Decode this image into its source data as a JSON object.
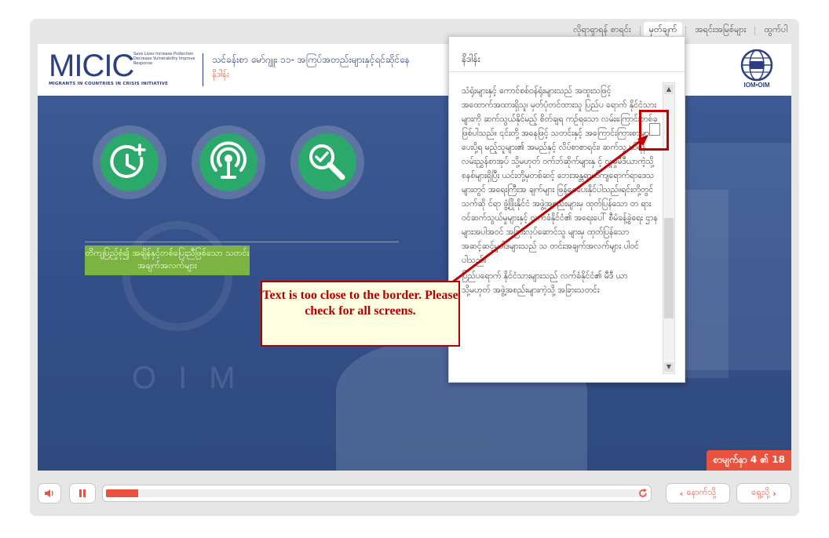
{
  "top_nav": {
    "tabs": [
      {
        "label": "လိုရာရှာရန် စာရင်း",
        "active": false
      },
      {
        "label": "မှတ်ချက်",
        "active": true
      },
      {
        "label": "အရင်းအမြစ်များ",
        "active": false
      },
      {
        "label": "ထွက်ပါ",
        "active": false
      }
    ]
  },
  "header": {
    "logo_word": "MICIC",
    "logo_tagline": "Save Lives Increase Protection Decrease Vulnerability Improve Response",
    "logo_subtitle": "MIGRANTS IN COUNTRIES IN CRISIS INITIATIVE",
    "course_title": "သင်ခန်းစာ မော်ဂျူး ၁၁- အကြပ်အတည်းများနှင့်ရင်ဆိုင်နေ",
    "course_subtitle": "နိဒါန်း",
    "partner_logo_text": "IOM•OIM"
  },
  "stage": {
    "icon_buttons": [
      {
        "icon": "clock-add-icon"
      },
      {
        "icon": "broadcast-icon"
      },
      {
        "icon": "search-check-icon"
      }
    ],
    "green_label": "တိကျပြည့်စုံ၍ အချိန်နှင့်တစ်ပြေးညီဖြစ်သော သတင်းအချက်အလက်များ",
    "background_text": "OIM",
    "counter": "စာမျက်နှာ 4 ၏ 18"
  },
  "popup": {
    "title": "နိဒါန်း",
    "paragraphs": [
      "သံရုံးများနှင့် ကောင်စစ်ဝန်ရုံးများသည် အထူးသဖြင့် အထောက်အထားရှိသူ၊ မှတ်ပုံတင်ထားသူ ပြည်ပ ရောက် နိုင်ငံသားများကို ဆက်သွယ်နိုင်မည့် စိတ်ချရ ကဉ်ရသော လမ်းကြောင်းတစ်ခုဖြစ်ပါသည်။ ၎င်းတို့ အနေဖြင့် သတင်းနှင့် အကြောင်းကြားစာများ ပေးပို့ရ မည့်သူများ၏ အမည်နှင့် လိပ်စာစာရင်း၊ ဆက်သွ ယ်ရန် လမ်းညွှန်စာအုပ် သို့မဟုတ် ဝက်ဘ်ဆိုက်များနှ င့် လူမှုမီဒီယာကဲ့သို့ စနစ်များရှိပြီး ယင်းတို့မှတစ်ဆင့် ဘေးအန္တရာယ်ကျရောက်ရာဒေသများတွင် အရေးကြီးအ ချက်များ ဖြန့်ဝေပေးနိုင်ပါသည်။ရင်းတို့တွင် သက်ဆို င်ရာ ဖွံ့ဖြိုးနိုင်ငံ အဖွဲ့အစည်းများမှ ထုတ်ပြန်သော တ ရားဝင်ဆက်သွယ်မှုများနှင့် လက်ခံနိုင်ငံ၏ အရေးပေါ် စီမံခန့်ခွဲရေး ဌာနများအပါအဝင် အခြားလုပ်ဆောင်သူ များမှ ထုတ်ပြန်သော အဆင့်ဆင့်မူဝါဒများသည် သ တင်းအချက်အလက်များ ပါဝင်ပါသည်။",
      "ပြည်ပရောက် နိုင်ငံသားများသည် လက်ခံနိုင်ငံ၏ မီဒီ ယာ သို့မဟုတ် အဖွဲ့အစည်းများကဲ့သို့ အခြားသတင်း"
    ]
  },
  "annotation": {
    "callout_text": "Text is too close to the border. Please check for all screens."
  },
  "controls": {
    "mute_icon": "speaker-icon",
    "pause_icon": "pause-icon",
    "progress_fraction": 0.06,
    "replay_icon": "replay-icon",
    "back_label": "နောက်သို့",
    "next_label": "ရှေ့သို့"
  },
  "colors": {
    "brand_blue": "#2b3e86",
    "accent_orange": "#e8523f",
    "icon_green": "#2aa96b",
    "label_green": "#7cb342",
    "annotation_red": "#b30000"
  }
}
